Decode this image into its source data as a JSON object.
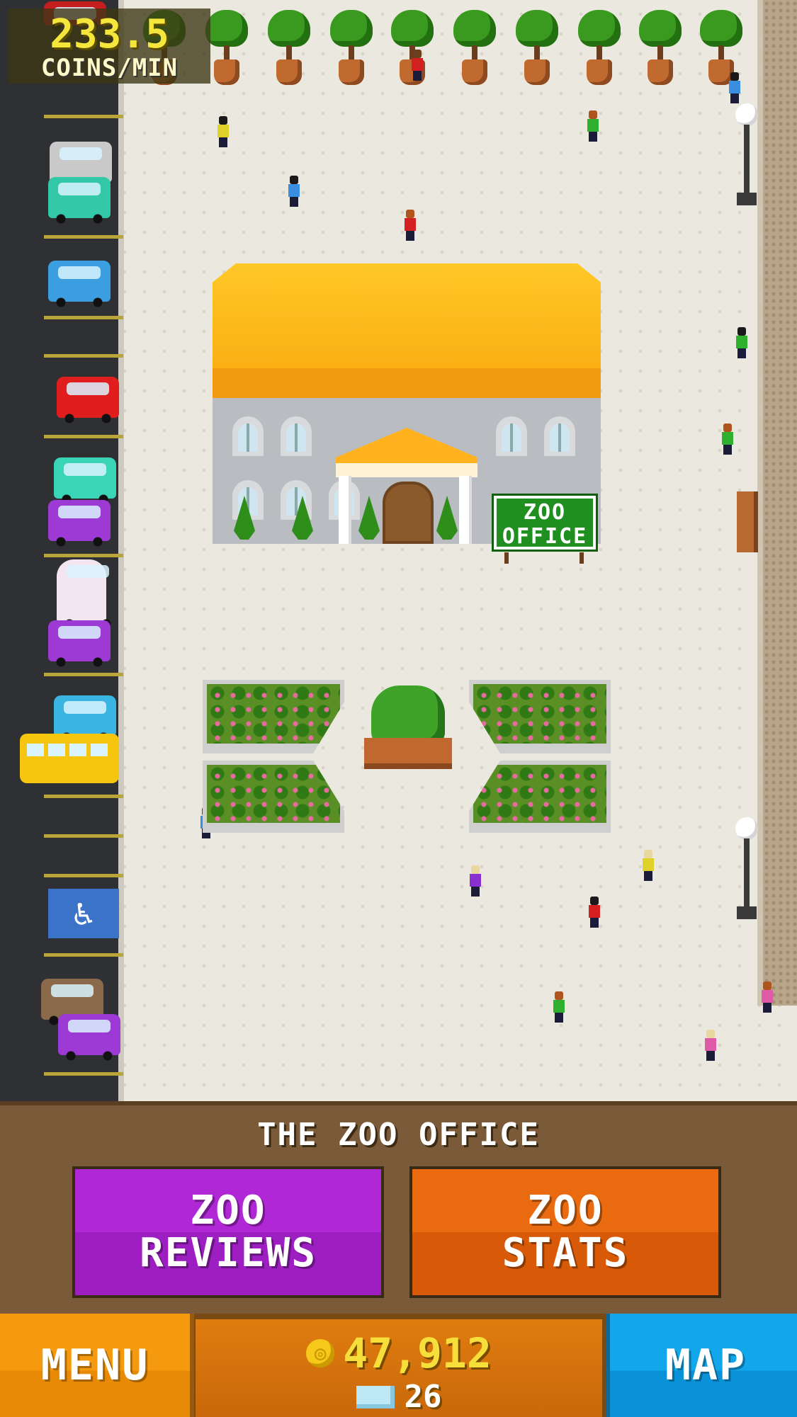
{
  "hud": {
    "rate_value": "233.5",
    "rate_unit": "COINS/MIN"
  },
  "building": {
    "sign_line1": "ZOO",
    "sign_line2": "OFFICE"
  },
  "panel": {
    "title": "THE ZOO OFFICE",
    "reviews_line1": "ZOO",
    "reviews_line2": "REVIEWS",
    "stats_line1": "ZOO",
    "stats_line2": "STATS"
  },
  "bottom_bar": {
    "menu_label": "MENU",
    "map_label": "MAP",
    "coins": "47,912",
    "gems": "26"
  },
  "colors": {
    "reviews_button": "#a524cc",
    "stats_button": "#e0620c",
    "menu_button": "#f59a0e",
    "map_button": "#12a6ea",
    "roof": "#ffc827",
    "coin_text": "#f6df3a"
  },
  "icons": [
    "coin-icon",
    "gem-icon",
    "parking-icon"
  ]
}
